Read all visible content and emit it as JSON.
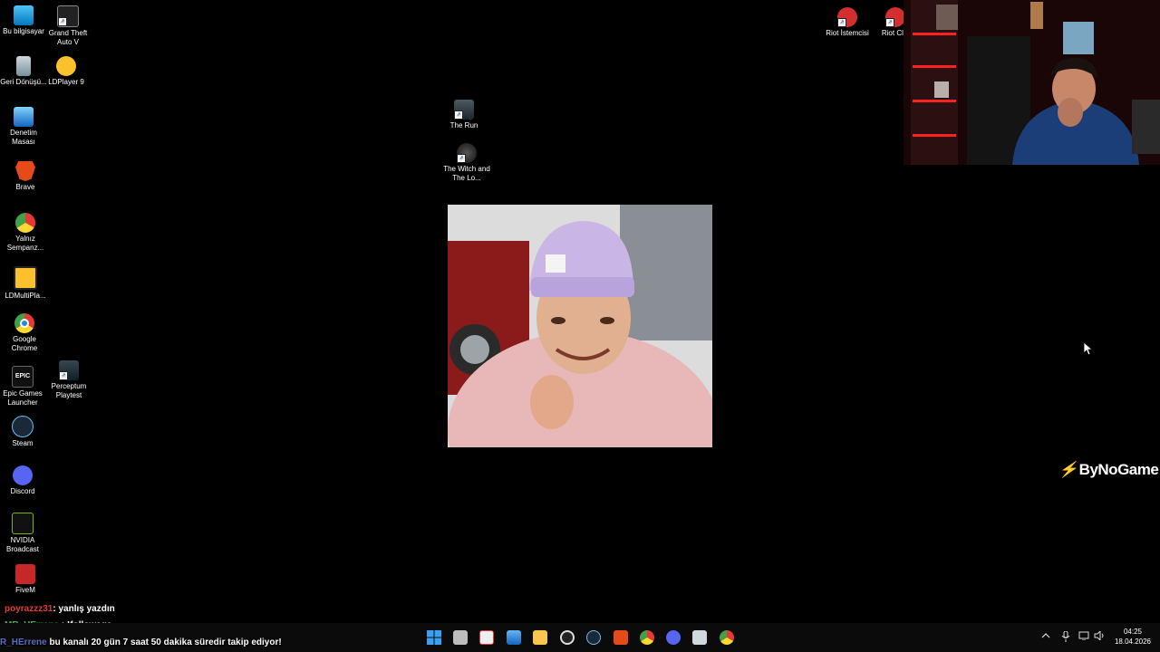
{
  "desktop_icons_left": [
    {
      "name": "this-pc-icon",
      "label": "Bu bilgisayar",
      "icon": "monitor"
    },
    {
      "name": "gta-icon",
      "label": "Grand Theft Auto V",
      "icon": "gta"
    },
    {
      "name": "recycle-bin-icon",
      "label": "Geri Dönüşü...",
      "icon": "trash"
    },
    {
      "name": "ldplayer-icon",
      "label": "LDPlayer 9",
      "icon": "ldplayer"
    },
    {
      "name": "control-panel-icon",
      "label": "Denetim Masası",
      "icon": "control-panel"
    },
    {
      "name": "brave-icon",
      "label": "Brave",
      "icon": "brave-lion"
    },
    {
      "name": "yalniz-icon",
      "label": "Yalnız Sempanz...",
      "icon": "chrome-variant"
    },
    {
      "name": "ldmultiplayer-icon",
      "label": "LDMultiPla...",
      "icon": "ldmultiplayer"
    },
    {
      "name": "chrome-icon",
      "label": "Google Chrome",
      "icon": "chrome"
    },
    {
      "name": "epic-icon",
      "label": "Epic Games Launcher",
      "icon": "epic"
    },
    {
      "name": "perceptum-icon",
      "label": "Perceptum Playtest",
      "icon": "game"
    },
    {
      "name": "steam-icon",
      "label": "Steam",
      "icon": "steam"
    },
    {
      "name": "discord-icon",
      "label": "Discord",
      "icon": "discord"
    },
    {
      "name": "nvidia-icon",
      "label": "NVIDIA Broadcast",
      "icon": "nvidia"
    },
    {
      "name": "fivem-icon",
      "label": "FiveM",
      "icon": "fivem"
    }
  ],
  "desktop_icons_center": [
    {
      "label": "The Run",
      "icon": "game"
    },
    {
      "label": "The Witch and The Lo...",
      "icon": "game"
    }
  ],
  "desktop_icons_top_right": [
    {
      "label": "Riot İstemcisi",
      "icon": "riot"
    },
    {
      "label": "Riot Clie",
      "icon": "riot"
    }
  ],
  "shortcut_glyph": "↗",
  "epic_text": "EPIC",
  "logo": {
    "mark": "⚡",
    "text": "ByNoGame"
  },
  "chat": [
    {
      "user": "poyrazzz31",
      "sep": ": ",
      "message": "yanlış yazdın",
      "user_color": "#e53935"
    },
    {
      "user": "MR_HErrene",
      "sep": " : ",
      "message": "!followage",
      "user_color": "#4caf50"
    },
    {
      "user": "R_HErrene",
      "sep": " ",
      "message": "bu kanalı 20 gün 7 saat 50 dakika süredir takip ediyor!",
      "user_color": "#5c6bc0"
    }
  ],
  "taskbar": {
    "apps": [
      "windows-start",
      "task-view",
      "notepad",
      "photos",
      "file-explorer",
      "obs",
      "steam",
      "brave",
      "chrome-variant",
      "discord",
      "app",
      "chrome"
    ],
    "tray_icons": [
      "chevron-up",
      "microphone",
      "network",
      "volume"
    ],
    "time": "04:25",
    "date": "18.04.2026"
  },
  "colors": {
    "desktop_bg": "#000000",
    "taskbar_bg": "#0b0b0b",
    "accent_red": "#e53935"
  }
}
